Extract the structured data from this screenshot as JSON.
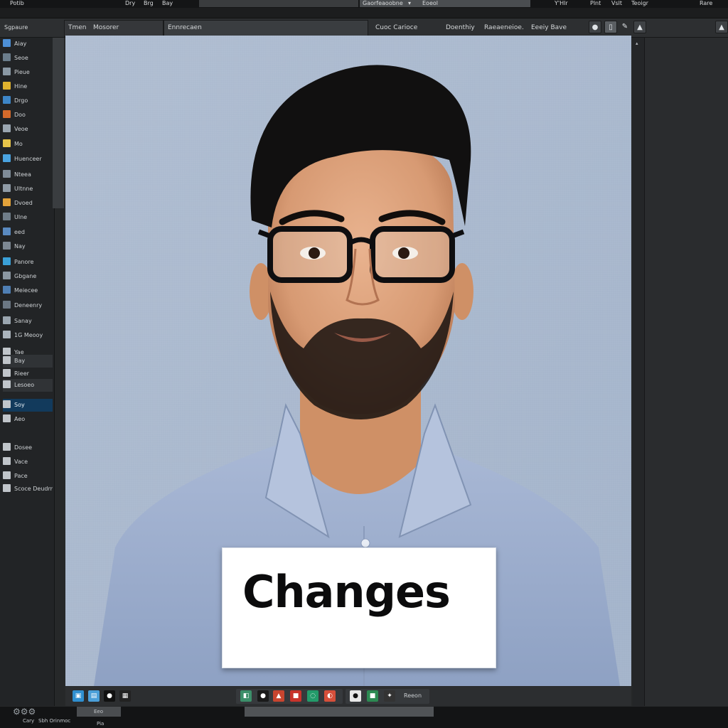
{
  "menubar": {
    "items": [
      "Potib",
      "Dry",
      "Brg",
      "Bay",
      "Gaorfeaoobne",
      "Eoeol",
      "Y'Hlr",
      "Plnt",
      "Vslt",
      "Teoigr",
      "Rare"
    ]
  },
  "toolbar": {
    "sidebar_title": "Sgpaure",
    "panel_tab_a": "Tmen",
    "panel_tab_b": "Mosorer",
    "panel_tab_c": "Ennrecaen",
    "center_label": "Cuoc Carioce",
    "right_label_a": "Doenthiy",
    "right_label_b": "Raeaeneioe.",
    "right_label_c": "Eeeiy Bave"
  },
  "sidebar": {
    "items": [
      {
        "label": "Aiay",
        "icon": "layer-icon",
        "color": "#4d8fd6"
      },
      {
        "label": "Seoe",
        "icon": "layer-icon",
        "color": "#6b7d8c"
      },
      {
        "label": "Pieue",
        "icon": "layer-icon",
        "color": "#8a98a4"
      },
      {
        "label": "Hine",
        "icon": "layer-icon",
        "color": "#e0b22e"
      },
      {
        "label": "Drgo",
        "icon": "layer-icon",
        "color": "#3d86c8"
      },
      {
        "label": "Doo",
        "icon": "layer-icon",
        "color": "#d56a2b"
      },
      {
        "label": "Veoe",
        "icon": "layer-icon",
        "color": "#9aa6b1"
      },
      {
        "label": "Mo",
        "icon": "layer-icon",
        "color": "#e7c449"
      },
      {
        "label": "Huenceer",
        "icon": "layer-icon",
        "color": "#4aa3e0"
      },
      {
        "label": "Nteea",
        "icon": "layer-icon",
        "color": "#7f8c98"
      },
      {
        "label": "Ultnne",
        "icon": "layer-icon",
        "color": "#8f9ba6"
      },
      {
        "label": "Dvoed",
        "icon": "layer-icon",
        "color": "#e2a23a"
      },
      {
        "label": "Ulne",
        "icon": "layer-icon",
        "color": "#6f7d89"
      },
      {
        "label": "eed",
        "icon": "layer-icon",
        "color": "#5a8ac0"
      },
      {
        "label": "Nay",
        "icon": "layer-icon",
        "color": "#7d8893"
      },
      {
        "label": "Panore",
        "icon": "layer-icon",
        "color": "#3aa0d8"
      },
      {
        "label": "Gbgane",
        "icon": "layer-icon",
        "color": "#8b97a2"
      },
      {
        "label": "Meiecee",
        "icon": "layer-icon",
        "color": "#4f7fb4"
      },
      {
        "label": "Deneenry",
        "icon": "layer-icon",
        "color": "#6b7783"
      },
      {
        "label": "Sanay",
        "icon": "layer-icon",
        "color": "#9aa5af"
      },
      {
        "label": "1G Meooy",
        "icon": "layer-icon",
        "color": "#aab3bb"
      },
      {
        "label": "Yae",
        "icon": "layer-icon",
        "color": "#c0c5ca"
      },
      {
        "label": "Bay",
        "icon": "layer-icon",
        "color": "#c0c5ca"
      },
      {
        "label": "Rieer",
        "icon": "layer-icon",
        "color": "#c0c5ca"
      },
      {
        "label": "Lesoeo",
        "icon": "layer-icon",
        "color": "#c0c5ca"
      },
      {
        "label": "Soy",
        "icon": "layer-icon",
        "color": "#c0c5ca"
      },
      {
        "label": "Aeo",
        "icon": "layer-icon",
        "color": "#c0c5ca"
      },
      {
        "label": "Dosee",
        "icon": "layer-icon",
        "color": "#c0c5ca"
      },
      {
        "label": "Vace",
        "icon": "layer-icon",
        "color": "#c0c5ca"
      },
      {
        "label": "Pace",
        "icon": "layer-icon",
        "color": "#c0c5ca"
      },
      {
        "label": "Scoce Deudrmer",
        "icon": "layer-icon",
        "color": "#c0c5ca"
      }
    ]
  },
  "canvas": {
    "caption": "Changes",
    "photo_background": "#a9b8cd"
  },
  "canvas_toolbar": {
    "right_label": "Reeon"
  },
  "status": {
    "left_a": "Cary",
    "left_b": "Sbh Orinmoc",
    "left_c": "Pia",
    "box_label": "Eeo"
  },
  "colors": {
    "chrome_dark": "#262829",
    "panel": "#2d2f31",
    "selection": "#123a5c",
    "canvas_bg": "#a9b8cd"
  }
}
